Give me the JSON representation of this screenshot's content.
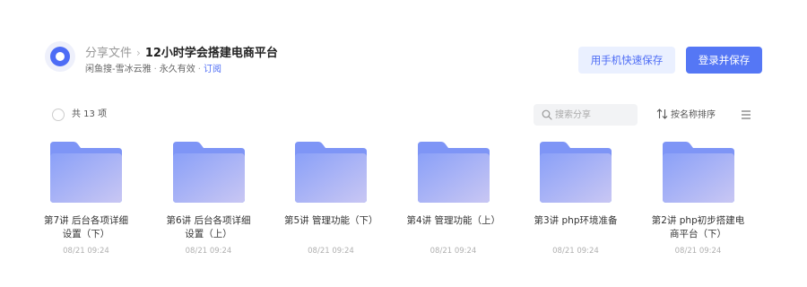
{
  "header": {
    "breadcrumb_root": "分享文件",
    "breadcrumb_separator": "›",
    "title": "12小时学会搭建电商平台",
    "sharer": "闲鱼搜-雪冰云雅",
    "dot": "·",
    "validity": "永久有效",
    "subscribe": "订阅"
  },
  "actions": {
    "mobile_save": "用手机快速保存",
    "login_save": "登录并保存"
  },
  "toolbar": {
    "count_text": "共 13 项",
    "search_placeholder": "搜索分享",
    "sort_label": "按名称排序"
  },
  "files": [
    {
      "name": "第7讲 后台各项详细设置（下）",
      "date": "08/21 09:24"
    },
    {
      "name": "第6讲 后台各项详细设置（上）",
      "date": "08/21 09:24"
    },
    {
      "name": "第5讲 管理功能（下）",
      "date": "08/21 09:24"
    },
    {
      "name": "第4讲 管理功能（上）",
      "date": "08/21 09:24"
    },
    {
      "name": "第3讲 php环境准备",
      "date": "08/21 09:24"
    },
    {
      "name": "第2讲 php初步搭建电商平台（下）",
      "date": "08/21 09:24"
    }
  ],
  "colors": {
    "accent": "#5577f5",
    "accent_light": "#eaf0ff",
    "folder_back": "#7e95f6",
    "folder_front_start": "#8aa0f8",
    "folder_front_end": "#c9c7f3"
  },
  "icons": {
    "logo": "cloud-logo-icon",
    "search": "search-icon",
    "sort": "sort-icon",
    "view": "list-view-icon",
    "folder": "folder-icon"
  }
}
